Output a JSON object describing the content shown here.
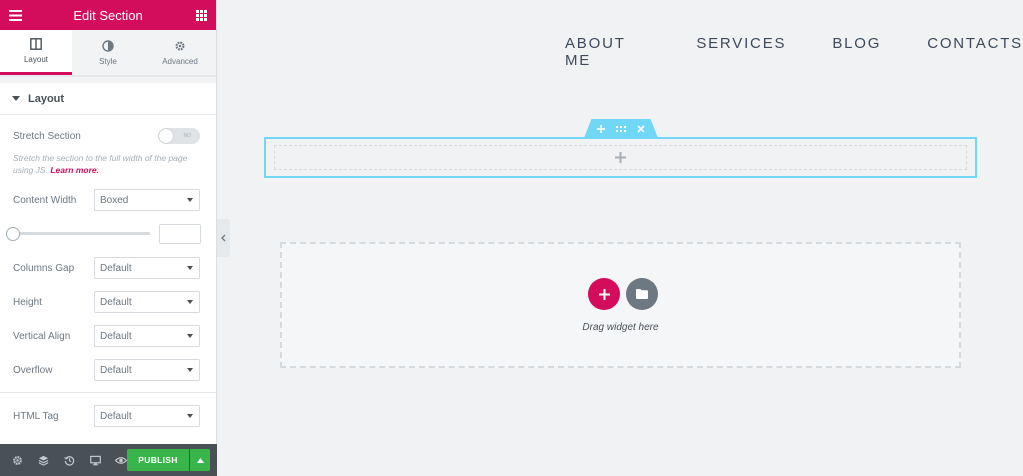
{
  "panel": {
    "title": "Edit Section",
    "tabs": [
      {
        "label": "Layout",
        "icon": "layout-icon",
        "active": true
      },
      {
        "label": "Style",
        "icon": "half-circle-icon",
        "active": false
      },
      {
        "label": "Advanced",
        "icon": "gear-icon",
        "active": false
      }
    ],
    "section_title": "Layout",
    "stretch": {
      "label": "Stretch Section",
      "toggle_text": "NO",
      "desc": "Stretch the section to the full width of the page using JS.",
      "link": "Learn more."
    },
    "content_width": {
      "label": "Content Width",
      "value": "Boxed"
    },
    "columns_gap": {
      "label": "Columns Gap",
      "value": "Default"
    },
    "height": {
      "label": "Height",
      "value": "Default"
    },
    "vertical_align": {
      "label": "Vertical Align",
      "value": "Default"
    },
    "overflow": {
      "label": "Overflow",
      "value": "Default"
    },
    "html_tag": {
      "label": "HTML Tag",
      "value": "Default"
    }
  },
  "footer": {
    "publish_label": "PUBLISH"
  },
  "nav": [
    "ABOUT ME",
    "SERVICES",
    "BLOG",
    "CONTACTS"
  ],
  "canvas": {
    "drop_text": "Drag widget here"
  },
  "colors": {
    "brand": "#d30c5c",
    "publish": "#39b54a",
    "section_outline": "#71d7f7",
    "footer_bg": "#495157"
  }
}
